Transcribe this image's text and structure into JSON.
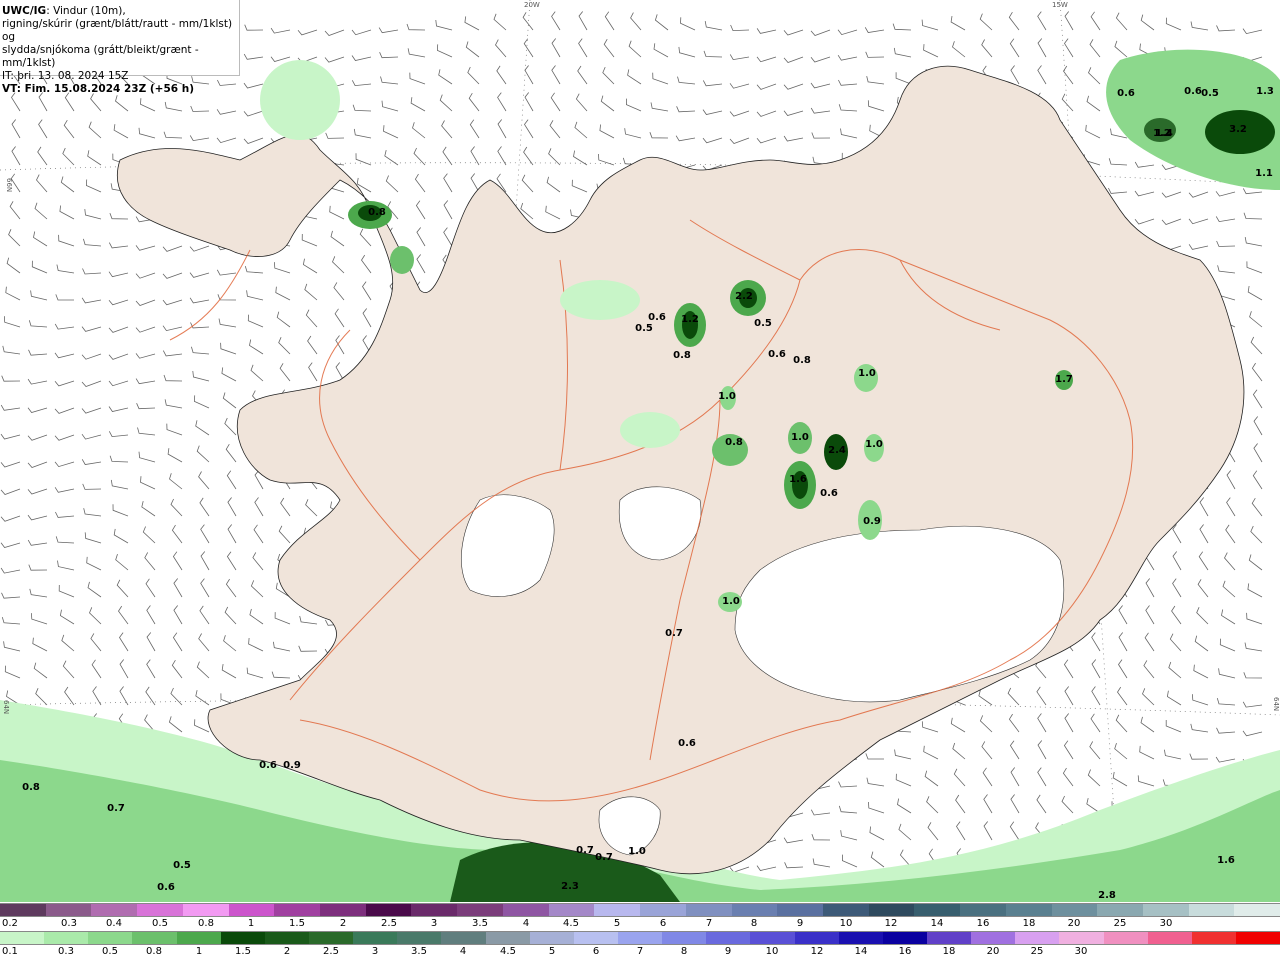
{
  "header": {
    "model": "UWC/IG",
    "line1_rest": ": Vindur (10m),",
    "line2": "rigning/skúrir (grænt/blátt/rautt - mm/1klst) og",
    "line3": "slydda/snjókoma (grátt/bleikt/grænt - mm/1klst)",
    "line4": "IT: þri. 13. 08. 2024 15Z",
    "line5": "VT: Fim. 15.08.2024 23Z (+56 h)"
  },
  "grid_labels": {
    "lon_20w": "20W",
    "lon_15w": "15W",
    "lat_66n": "66N",
    "lat_64n": "64N"
  },
  "precip_labels": [
    "0.6",
    "0.6",
    "0.5",
    "1.2",
    "1.4",
    "3.2",
    "1.1",
    "1.3",
    "0.8",
    "0.6",
    "0.5",
    "1.2",
    "0.8",
    "2.2",
    "0.5",
    "0.6",
    "0.8",
    "1.0",
    "1.7",
    "1.0",
    "0.8",
    "1.0",
    "2.4",
    "1.0",
    "1.6",
    "0.6",
    "0.9",
    "1.0",
    "0.7",
    "0.6",
    "0.6",
    "0.9",
    "0.8",
    "0.7",
    "0.5",
    "0.6",
    "0.7",
    "0.7",
    "1.0",
    "2.3",
    "1.6",
    "2.8"
  ],
  "legend_snow": {
    "colors": [
      "#5e3a5e",
      "#8b5b8b",
      "#b06db0",
      "#d873d8",
      "#f29af2",
      "#cc55cc",
      "#a040a0",
      "#7d2f7d",
      "#4a0a4a",
      "#6a2a6a",
      "#7b3d7b",
      "#8f56a3",
      "#a488c8",
      "#b8b8ee",
      "#9aa4d8",
      "#8090c0",
      "#6a7fb0",
      "#5a70a0",
      "#3d5a78",
      "#2e4a5e",
      "#375e6e",
      "#4a7080",
      "#5a8090",
      "#6e909e",
      "#8aa8b0",
      "#a6c0c4",
      "#c8dcdc",
      "#e0ecea"
    ],
    "labels": [
      "0.2",
      "0.3",
      "0.4",
      "0.5",
      "0.8",
      "1",
      "1.5",
      "2",
      "2.5",
      "3",
      "3.5",
      "4",
      "4.5",
      "5",
      "6",
      "7",
      "8",
      "9",
      "10",
      "12",
      "14",
      "16",
      "18",
      "20",
      "25",
      "30"
    ]
  },
  "legend_rain": {
    "colors": [
      "#c8f5c8",
      "#aaeaaa",
      "#8cd88c",
      "#6cc06c",
      "#4ca84c",
      "#0a4a0a",
      "#1a5a1a",
      "#2a6a2a",
      "#3a7a5a",
      "#4a7a6a",
      "#607e7e",
      "#8a9aa6",
      "#a6b0d6",
      "#b8c0f0",
      "#9aa4ee",
      "#8088e6",
      "#6a6ade",
      "#5a50d6",
      "#3a30c8",
      "#1a10b0",
      "#0a00a0",
      "#6040c8",
      "#a070e0",
      "#d8a0f0",
      "#f0b0e0",
      "#f090c0",
      "#f06090",
      "#f03030",
      "#f00000"
    ],
    "labels": [
      "0.1",
      "0.3",
      "0.5",
      "0.8",
      "1",
      "1.5",
      "2",
      "2.5",
      "3",
      "3.5",
      "4",
      "4.5",
      "5",
      "6",
      "7",
      "8",
      "9",
      "10",
      "12",
      "14",
      "16",
      "18",
      "20",
      "25",
      "30"
    ]
  }
}
